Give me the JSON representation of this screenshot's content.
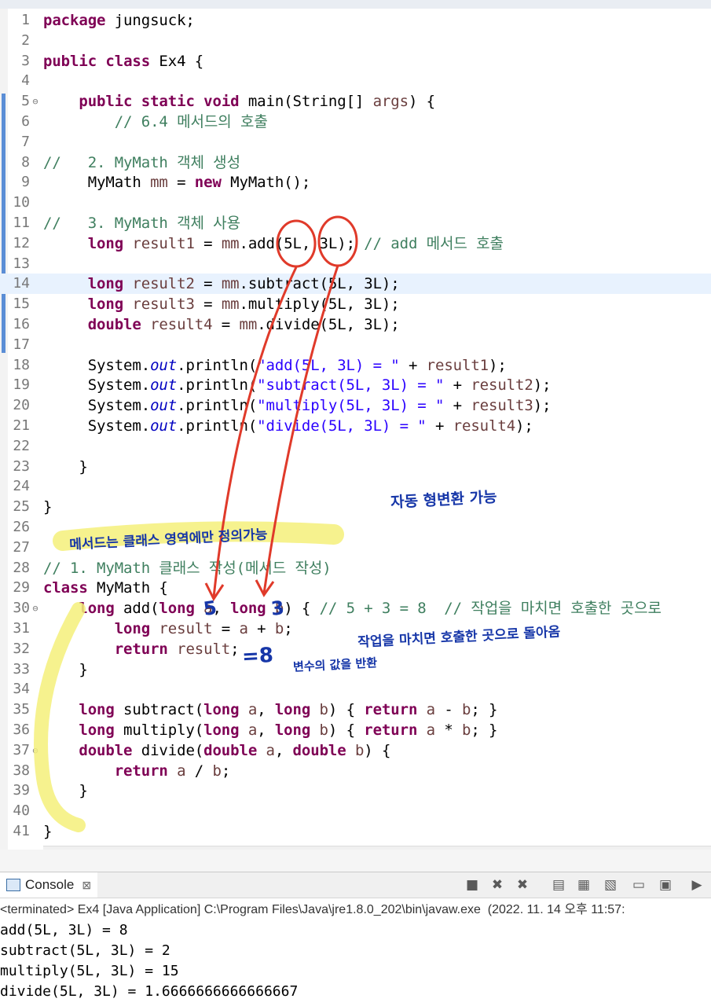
{
  "editor": {
    "lines": [
      {
        "n": "1",
        "fold": "",
        "segs": [
          {
            "t": "package",
            "c": "kw"
          },
          {
            "t": " jungsuck;"
          }
        ]
      },
      {
        "n": "2",
        "fold": "",
        "segs": []
      },
      {
        "n": "3",
        "fold": "",
        "segs": [
          {
            "t": "public",
            "c": "kw"
          },
          {
            "t": " "
          },
          {
            "t": "class",
            "c": "kw"
          },
          {
            "t": " Ex4 {"
          }
        ]
      },
      {
        "n": "4",
        "fold": "",
        "segs": []
      },
      {
        "n": "5",
        "fold": "⊖",
        "segs": [
          {
            "t": "    "
          },
          {
            "t": "public",
            "c": "kw"
          },
          {
            "t": " "
          },
          {
            "t": "static",
            "c": "kw"
          },
          {
            "t": " "
          },
          {
            "t": "void",
            "c": "kw"
          },
          {
            "t": " main(String[] "
          },
          {
            "t": "args",
            "c": "var"
          },
          {
            "t": ") {"
          }
        ]
      },
      {
        "n": "6",
        "fold": "",
        "segs": [
          {
            "t": "        "
          },
          {
            "t": "// 6.4 메서드의 호출",
            "c": "cm"
          }
        ]
      },
      {
        "n": "7",
        "fold": "",
        "segs": []
      },
      {
        "n": "8",
        "fold": "",
        "segs": [
          {
            "t": "//   2. MyMath 객체 생성",
            "c": "cm"
          }
        ]
      },
      {
        "n": "9",
        "fold": "",
        "segs": [
          {
            "t": "     MyMath "
          },
          {
            "t": "mm",
            "c": "var"
          },
          {
            "t": " = "
          },
          {
            "t": "new",
            "c": "kw"
          },
          {
            "t": " MyMath();"
          }
        ]
      },
      {
        "n": "10",
        "fold": "",
        "segs": []
      },
      {
        "n": "11",
        "fold": "",
        "segs": [
          {
            "t": "//   3. MyMath 객체 사용",
            "c": "cm"
          }
        ]
      },
      {
        "n": "12",
        "fold": "",
        "segs": [
          {
            "t": "     "
          },
          {
            "t": "long",
            "c": "kw"
          },
          {
            "t": " "
          },
          {
            "t": "result1",
            "c": "var"
          },
          {
            "t": " = "
          },
          {
            "t": "mm",
            "c": "var"
          },
          {
            "t": ".add(5L, 3L); "
          },
          {
            "t": "// add 메서드 호출",
            "c": "cm"
          }
        ]
      },
      {
        "n": "13",
        "fold": "",
        "segs": []
      },
      {
        "n": "14",
        "fold": "",
        "current": true,
        "segs": [
          {
            "t": "     "
          },
          {
            "t": "long",
            "c": "kw"
          },
          {
            "t": " "
          },
          {
            "t": "result2",
            "c": "var"
          },
          {
            "t": " = "
          },
          {
            "t": "mm",
            "c": "var"
          },
          {
            "t": ".subtract(5L, 3L);"
          }
        ]
      },
      {
        "n": "15",
        "fold": "",
        "segs": [
          {
            "t": "     "
          },
          {
            "t": "long",
            "c": "kw"
          },
          {
            "t": " "
          },
          {
            "t": "result3",
            "c": "var"
          },
          {
            "t": " = "
          },
          {
            "t": "mm",
            "c": "var"
          },
          {
            "t": ".multiply(5L, 3L);"
          }
        ]
      },
      {
        "n": "16",
        "fold": "",
        "segs": [
          {
            "t": "     "
          },
          {
            "t": "double",
            "c": "kw"
          },
          {
            "t": " "
          },
          {
            "t": "result4",
            "c": "var"
          },
          {
            "t": " = "
          },
          {
            "t": "mm",
            "c": "var"
          },
          {
            "t": ".divide(5L, 3L);"
          }
        ]
      },
      {
        "n": "17",
        "fold": "",
        "segs": []
      },
      {
        "n": "18",
        "fold": "",
        "segs": [
          {
            "t": "     System."
          },
          {
            "t": "out",
            "c": "fld"
          },
          {
            "t": ".println("
          },
          {
            "t": "\"add(5L, 3L) = \"",
            "c": "str"
          },
          {
            "t": " + "
          },
          {
            "t": "result1",
            "c": "var"
          },
          {
            "t": ");"
          }
        ]
      },
      {
        "n": "19",
        "fold": "",
        "segs": [
          {
            "t": "     System."
          },
          {
            "t": "out",
            "c": "fld"
          },
          {
            "t": ".println("
          },
          {
            "t": "\"subtract(5L, 3L) = \"",
            "c": "str"
          },
          {
            "t": " + "
          },
          {
            "t": "result2",
            "c": "var"
          },
          {
            "t": ");"
          }
        ]
      },
      {
        "n": "20",
        "fold": "",
        "segs": [
          {
            "t": "     System."
          },
          {
            "t": "out",
            "c": "fld"
          },
          {
            "t": ".println("
          },
          {
            "t": "\"multiply(5L, 3L) = \"",
            "c": "str"
          },
          {
            "t": " + "
          },
          {
            "t": "result3",
            "c": "var"
          },
          {
            "t": ");"
          }
        ]
      },
      {
        "n": "21",
        "fold": "",
        "segs": [
          {
            "t": "     System."
          },
          {
            "t": "out",
            "c": "fld"
          },
          {
            "t": ".println("
          },
          {
            "t": "\"divide(5L, 3L) = \"",
            "c": "str"
          },
          {
            "t": " + "
          },
          {
            "t": "result4",
            "c": "var"
          },
          {
            "t": ");"
          }
        ]
      },
      {
        "n": "22",
        "fold": "",
        "segs": []
      },
      {
        "n": "23",
        "fold": "",
        "segs": [
          {
            "t": "    }"
          }
        ]
      },
      {
        "n": "24",
        "fold": "",
        "segs": []
      },
      {
        "n": "25",
        "fold": "",
        "segs": [
          {
            "t": "}"
          }
        ]
      },
      {
        "n": "26",
        "fold": "",
        "segs": []
      },
      {
        "n": "27",
        "fold": "",
        "segs": []
      },
      {
        "n": "28",
        "fold": "",
        "segs": [
          {
            "t": "// 1. MyMath 클래스 작성(메서드 작성)",
            "c": "cm"
          }
        ]
      },
      {
        "n": "29",
        "fold": "",
        "segs": [
          {
            "t": "class",
            "c": "kw"
          },
          {
            "t": " MyMath {"
          }
        ]
      },
      {
        "n": "30",
        "fold": "⊖",
        "segs": [
          {
            "t": "    "
          },
          {
            "t": "long",
            "c": "kw"
          },
          {
            "t": " add("
          },
          {
            "t": "long",
            "c": "kw"
          },
          {
            "t": " "
          },
          {
            "t": "a",
            "c": "var"
          },
          {
            "t": ", "
          },
          {
            "t": "long",
            "c": "kw"
          },
          {
            "t": " "
          },
          {
            "t": "b",
            "c": "var"
          },
          {
            "t": ") { "
          },
          {
            "t": "// 5 + 3 = 8  // 작업을 마치면 호출한 곳으로",
            "c": "cm"
          }
        ]
      },
      {
        "n": "31",
        "fold": "",
        "segs": [
          {
            "t": "        "
          },
          {
            "t": "long",
            "c": "kw"
          },
          {
            "t": " "
          },
          {
            "t": "result",
            "c": "var"
          },
          {
            "t": " = "
          },
          {
            "t": "a",
            "c": "var"
          },
          {
            "t": " + "
          },
          {
            "t": "b",
            "c": "var"
          },
          {
            "t": ";"
          }
        ]
      },
      {
        "n": "32",
        "fold": "",
        "segs": [
          {
            "t": "        "
          },
          {
            "t": "return",
            "c": "kw"
          },
          {
            "t": " "
          },
          {
            "t": "result",
            "c": "var"
          },
          {
            "t": ";"
          }
        ]
      },
      {
        "n": "33",
        "fold": "",
        "segs": [
          {
            "t": "    }"
          }
        ]
      },
      {
        "n": "34",
        "fold": "",
        "segs": []
      },
      {
        "n": "35",
        "fold": "",
        "segs": [
          {
            "t": "    "
          },
          {
            "t": "long",
            "c": "kw"
          },
          {
            "t": " subtract("
          },
          {
            "t": "long",
            "c": "kw"
          },
          {
            "t": " "
          },
          {
            "t": "a",
            "c": "var"
          },
          {
            "t": ", "
          },
          {
            "t": "long",
            "c": "kw"
          },
          {
            "t": " "
          },
          {
            "t": "b",
            "c": "var"
          },
          {
            "t": ") { "
          },
          {
            "t": "return",
            "c": "kw"
          },
          {
            "t": " "
          },
          {
            "t": "a",
            "c": "var"
          },
          {
            "t": " - "
          },
          {
            "t": "b",
            "c": "var"
          },
          {
            "t": "; }"
          }
        ]
      },
      {
        "n": "36",
        "fold": "",
        "segs": [
          {
            "t": "    "
          },
          {
            "t": "long",
            "c": "kw"
          },
          {
            "t": " multiply("
          },
          {
            "t": "long",
            "c": "kw"
          },
          {
            "t": " "
          },
          {
            "t": "a",
            "c": "var"
          },
          {
            "t": ", "
          },
          {
            "t": "long",
            "c": "kw"
          },
          {
            "t": " "
          },
          {
            "t": "b",
            "c": "var"
          },
          {
            "t": ") { "
          },
          {
            "t": "return",
            "c": "kw"
          },
          {
            "t": " "
          },
          {
            "t": "a",
            "c": "var"
          },
          {
            "t": " * "
          },
          {
            "t": "b",
            "c": "var"
          },
          {
            "t": "; }"
          }
        ]
      },
      {
        "n": "37",
        "fold": "⊖",
        "segs": [
          {
            "t": "    "
          },
          {
            "t": "double",
            "c": "kw"
          },
          {
            "t": " divide("
          },
          {
            "t": "double",
            "c": "kw"
          },
          {
            "t": " "
          },
          {
            "t": "a",
            "c": "var"
          },
          {
            "t": ", "
          },
          {
            "t": "double",
            "c": "kw"
          },
          {
            "t": " "
          },
          {
            "t": "b",
            "c": "var"
          },
          {
            "t": ") {"
          }
        ]
      },
      {
        "n": "38",
        "fold": "",
        "segs": [
          {
            "t": "        "
          },
          {
            "t": "return",
            "c": "kw"
          },
          {
            "t": " "
          },
          {
            "t": "a",
            "c": "var"
          },
          {
            "t": " / "
          },
          {
            "t": "b",
            "c": "var"
          },
          {
            "t": ";"
          }
        ]
      },
      {
        "n": "39",
        "fold": "",
        "segs": [
          {
            "t": "    }"
          }
        ]
      },
      {
        "n": "40",
        "fold": "",
        "segs": []
      },
      {
        "n": "41",
        "fold": "",
        "segs": [
          {
            "t": "}"
          }
        ]
      }
    ]
  },
  "console": {
    "tab_label": "Console",
    "close_icon": "⊠",
    "status": "<terminated> Ex4 [Java Application] C:\\Program Files\\Java\\jre1.8.0_202\\bin\\javaw.exe  (2022. 11. 14 오후 11:57:",
    "output": [
      "add(5L, 3L) = 8",
      "subtract(5L, 3L) = 2",
      "multiply(5L, 3L) = 15",
      "divide(5L, 3L) = 1.6666666666666667"
    ],
    "toolbar_icons": [
      "stop-icon",
      "remove-launch-icon",
      "remove-all-icon",
      "clear-console-icon",
      "scroll-lock-icon",
      "word-wrap-icon",
      "show-on-output-icon",
      "show-on-error-icon",
      "open-console-icon"
    ]
  },
  "annotations": {
    "auto_cast": "자동 형변환 가능",
    "class_only": "메서드는 클래스 영역에만 정의가능",
    "go_back": "작업을 마치면 호출한 곳으로 돌아옴",
    "returns": "변수의 값을 반환",
    "num5": "5",
    "num3": "3",
    "eq8": "=8"
  },
  "colors": {
    "keyword": "#7f0055",
    "comment": "#3f7f5f",
    "string": "#2a00ff",
    "field": "#0000c0",
    "local_var": "#6a3e3e",
    "ink_red": "#e03a2a",
    "ink_blue": "#1636a8",
    "highlighter": "#f5f07a"
  }
}
